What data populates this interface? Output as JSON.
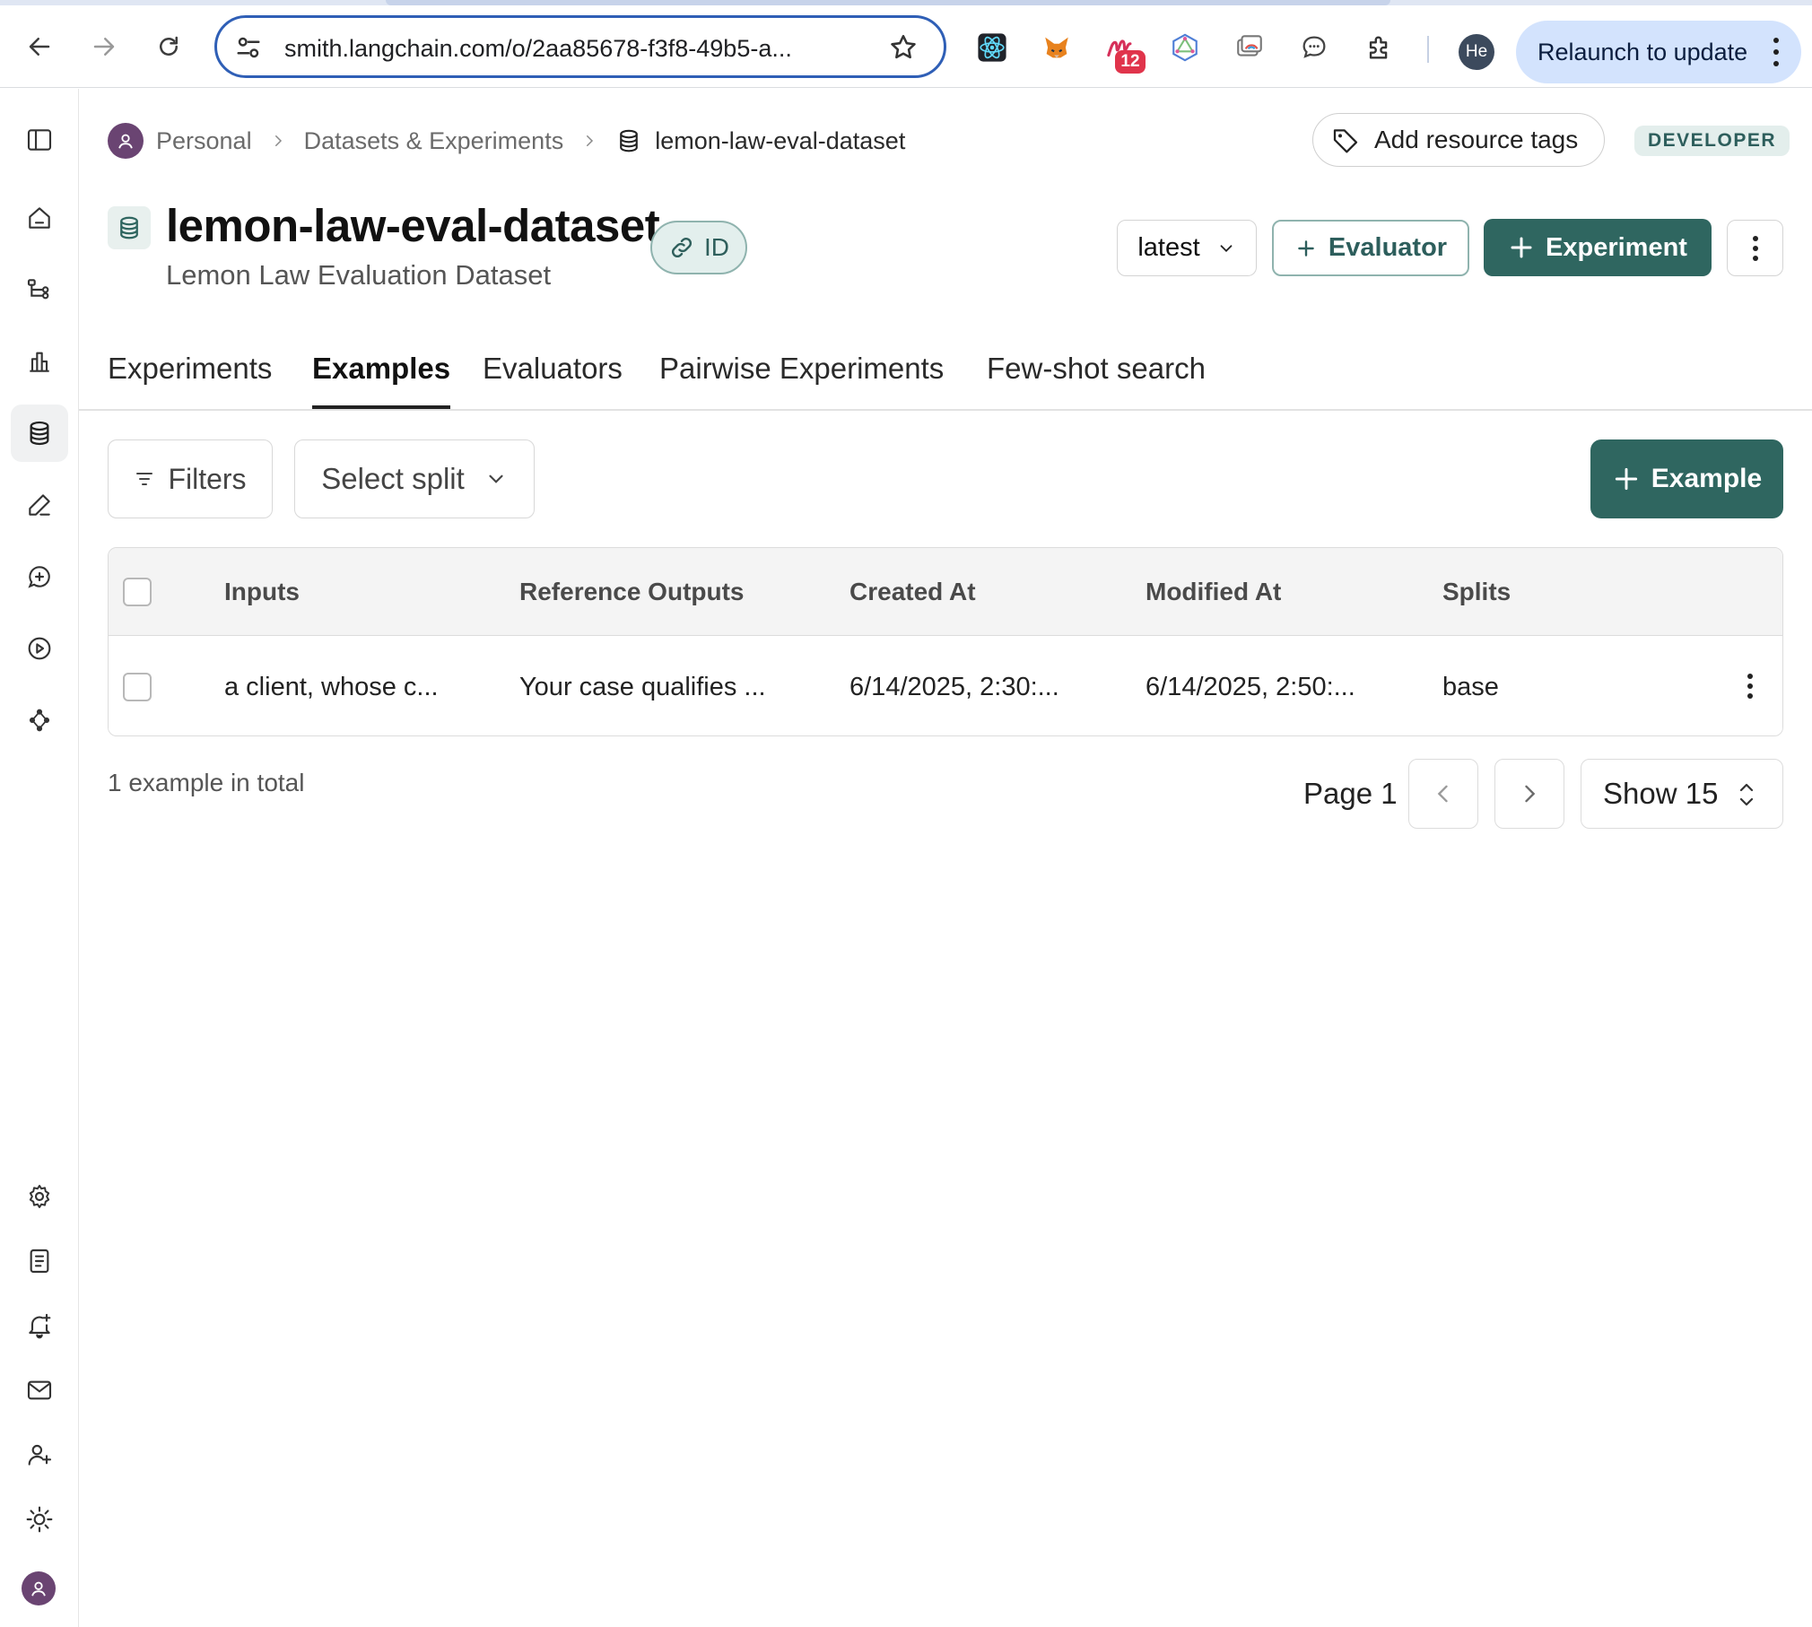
{
  "browser": {
    "url": "smith.langchain.com/o/2aa85678-f3f8-49b5-a...",
    "extension_badge": "12",
    "profile_initials": "He",
    "relaunch_label": "Relaunch to update"
  },
  "breadcrumb": {
    "workspace": "Personal",
    "section": "Datasets & Experiments",
    "current": "lemon-law-eval-dataset"
  },
  "header": {
    "add_tags_label": "Add resource tags",
    "role_badge": "DEVELOPER",
    "title": "lemon-law-eval-dataset",
    "subtitle": "Lemon Law Evaluation Dataset",
    "id_label": "ID",
    "version_selected": "latest",
    "evaluator_button": "Evaluator",
    "experiment_button": "Experiment"
  },
  "tabs": [
    {
      "label": "Experiments",
      "active": false
    },
    {
      "label": "Examples",
      "active": true
    },
    {
      "label": "Evaluators",
      "active": false
    },
    {
      "label": "Pairwise Experiments",
      "active": false
    },
    {
      "label": "Few-shot search",
      "active": false
    }
  ],
  "toolbar": {
    "filters_label": "Filters",
    "split_placeholder": "Select split",
    "add_example_label": "Example"
  },
  "table": {
    "columns": [
      "Inputs",
      "Reference Outputs",
      "Created At",
      "Modified At",
      "Splits"
    ],
    "rows": [
      {
        "inputs": "a client, whose c...",
        "reference_outputs": "Your case qualifies ...",
        "created_at": "6/14/2025, 2:30:...",
        "modified_at": "6/14/2025, 2:50:...",
        "splits": "base"
      }
    ]
  },
  "footer": {
    "total_text": "1 example in total",
    "page_label": "Page 1",
    "page_size_label": "Show 15"
  },
  "colors": {
    "accent": "#2f6660",
    "accent_light": "#e3efed",
    "omnibox_border": "#2f5fb6",
    "relaunch_bg": "#d3e3fd"
  }
}
